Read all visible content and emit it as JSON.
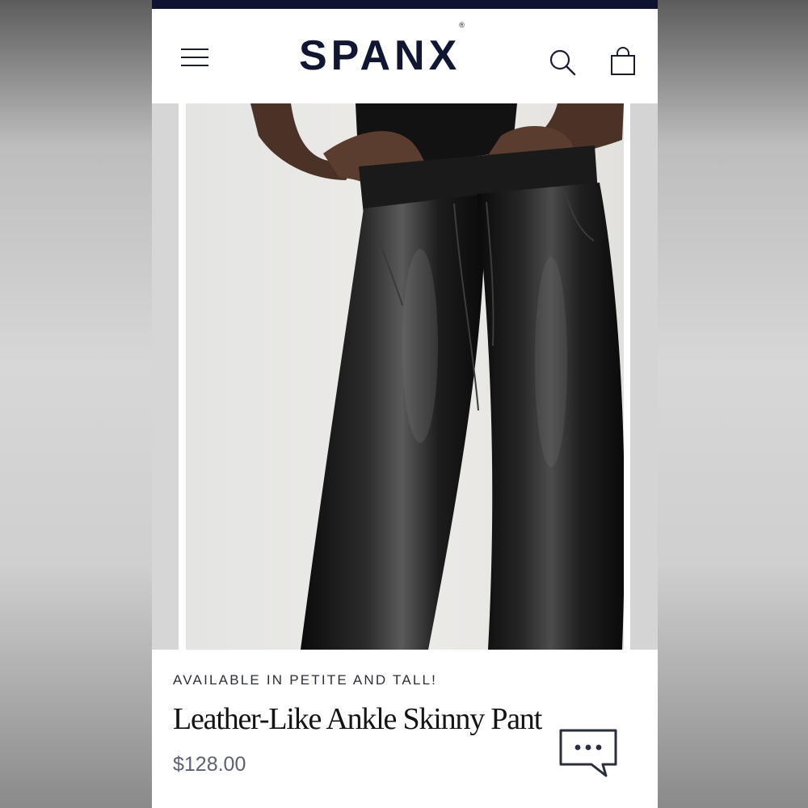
{
  "header": {
    "logo_text": "SPANX",
    "logo_mark": "®",
    "icons": [
      "menu-icon",
      "search-icon",
      "shopping-bag-icon"
    ]
  },
  "hero": {
    "image": "product-photo: model wearing black leather-like skinny pants"
  },
  "product": {
    "promo": "AVAILABLE IN PETITE AND TALL!",
    "title": "Leather-Like Ankle Skinny Pant",
    "price": "$128.00"
  },
  "chat": {
    "icon": "chat-bubble-icon"
  },
  "colors": {
    "top_bar": "#0e1430",
    "logo": "#111733",
    "price": "#5d6175",
    "pants": "#111111"
  }
}
